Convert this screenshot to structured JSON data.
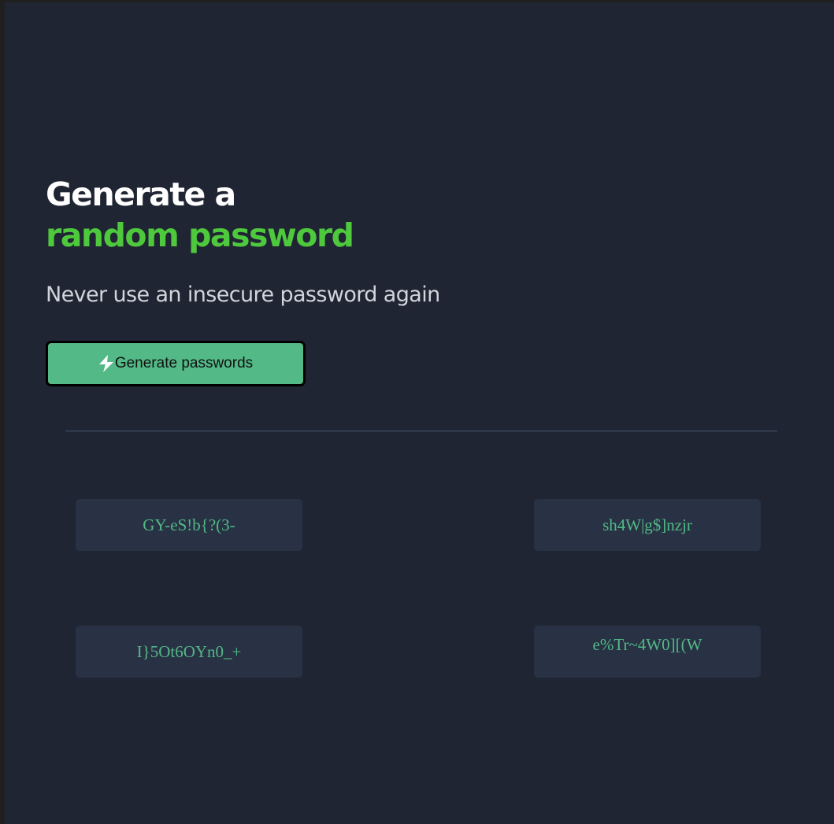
{
  "hero": {
    "title_line1": "Generate a",
    "title_line2": "random password",
    "subtitle": "Never use an insecure password again"
  },
  "generate_button": {
    "label": "Generate passwords",
    "icon": "lightning-bolt-icon"
  },
  "passwords": [
    "GY-eS!b{?(3-",
    "sh4W|g$]nzjr",
    "I}5Ot6OYn0_+",
    "e%Tr~4W0][(W"
  ],
  "colors": {
    "background": "#1f2532",
    "accent_green": "#4ec83c",
    "button_green": "#52b987",
    "password_box": "#283244",
    "password_text": "#52b987"
  }
}
